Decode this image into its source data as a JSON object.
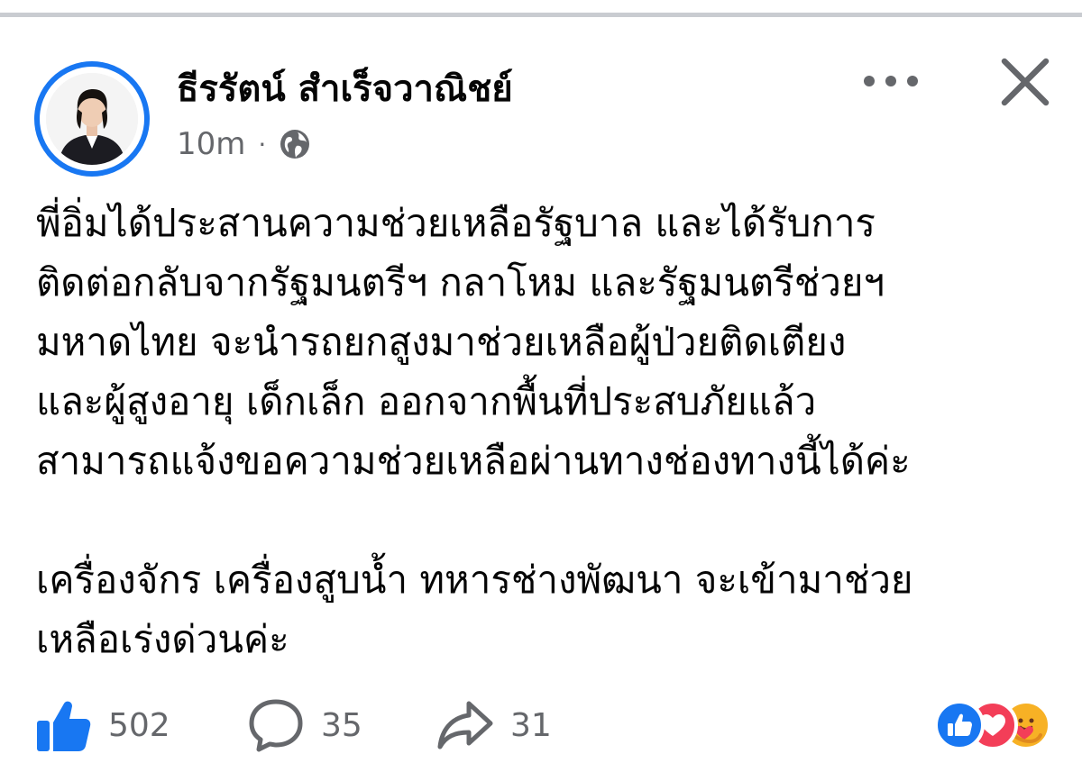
{
  "post": {
    "author": "ธีรรัตน์ สำเร็จวาณิชย์",
    "time": "10m",
    "separator": "·",
    "audience_icon": "globe-icon",
    "paragraphs": [
      "พี่อิ่มได้ประสานความช่วยเหลือรัฐบาล และได้รับการ\nติดต่อกลับจากรัฐมนตรีฯ กลาโหม และรัฐมนตรีช่วยฯ\nมหาดไทย จะนำรถยกสูงมาช่วยเหลือผู้ป่วยติดเตียง\nและผู้สูงอายุ เด็กเล็ก ออกจากพื้นที่ประสบภัยแล้ว\nสามารถแจ้งขอความช่วยเหลือผ่านทางช่องทางนี้ได้ค่ะ",
      "เครื่องจักร เครื่องสูบน้ำ ทหารช่างพัฒนา จะเข้ามาช่วย\nเหลือเร่งด่วนค่ะ"
    ]
  },
  "stats": {
    "likes": "502",
    "comments": "35",
    "shares": "31"
  },
  "reactions": [
    "like",
    "love",
    "care"
  ],
  "colors": {
    "accent": "#1877f2",
    "secondary_text": "#65676b",
    "love": "#f33e58",
    "care": "#f7b125"
  }
}
